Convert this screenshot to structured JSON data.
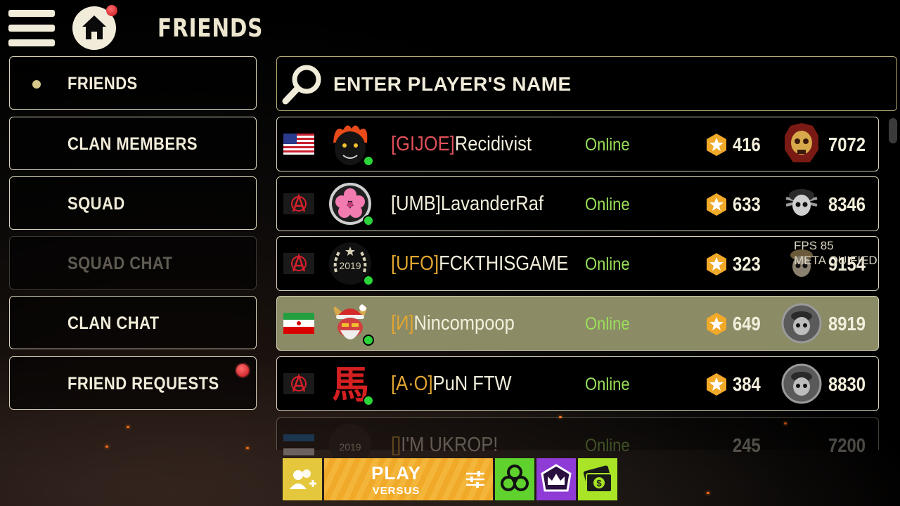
{
  "header": {
    "title": "FRIENDS"
  },
  "menu": [
    {
      "label": "FRIENDS",
      "active": true,
      "disabled": false,
      "notify": false
    },
    {
      "label": "CLAN MEMBERS",
      "active": false,
      "disabled": false,
      "notify": false
    },
    {
      "label": "SQUAD",
      "active": false,
      "disabled": false,
      "notify": false
    },
    {
      "label": "SQUAD CHAT",
      "active": false,
      "disabled": true,
      "notify": false
    },
    {
      "label": "CLAN CHAT",
      "active": false,
      "disabled": false,
      "notify": false
    },
    {
      "label": "FRIEND REQUESTS",
      "active": false,
      "disabled": false,
      "notify": true
    }
  ],
  "search": {
    "placeholder": "ENTER PLAYER'S NAME",
    "value": ""
  },
  "friends": [
    {
      "flag": "usa-flag",
      "avatar": "black-panther-fire-avatar",
      "tag": "[GIJOE]",
      "tag_color": "#e0505a",
      "name": "Recidivist",
      "status": "Online",
      "level": "416",
      "rank_icon": "golden-skull-rank-icon",
      "score": "7072"
    },
    {
      "flag": "anarchy-flag",
      "avatar": "pink-sakura-avatar",
      "tag": "[UMB]",
      "tag_color": "#f4efdc",
      "name": "LavanderRaf",
      "status": "Online",
      "level": "633",
      "rank_icon": "skull-beret-rank-icon",
      "score": "8346"
    },
    {
      "flag": "anarchy-flag",
      "avatar": "2019-laurel-avatar",
      "tag": "[UFO]",
      "tag_color": "#e0a531",
      "name": "FCKTHISGAME",
      "status": "Online",
      "level": "323",
      "rank_icon": "bronze-skull-rank-icon",
      "score": "9154"
    },
    {
      "flag": "iran-flag",
      "avatar": "santa-devil-avatar",
      "tag": "[И]",
      "tag_color": "#e0a531",
      "name": "Nincompoop",
      "status": "Online",
      "level": "649",
      "rank_icon": "silver-skull-rank-icon",
      "score": "8919",
      "selected": true
    },
    {
      "flag": "anarchy-flag",
      "avatar": "red-kanji-avatar",
      "tag": "[A·O]",
      "tag_color": "#e0a531",
      "name": "PuN FTW",
      "status": "Online",
      "level": "384",
      "rank_icon": "silver-skull-rank-icon",
      "score": "8830"
    },
    {
      "flag": "estonia-flag",
      "avatar": "2019-laurel-avatar",
      "tag": "[]",
      "tag_color": "#e0a531",
      "name": "I'M UKROP!",
      "status": "Online",
      "level": "245",
      "rank_icon": "bronze-skull-rank-icon",
      "score": "7200",
      "partial": true
    }
  ],
  "overlay": {
    "fps": "FPS 85",
    "meta": "META QUIFIED"
  },
  "bottom_bar": {
    "play_label": "PLAY",
    "play_mode": "VERSUS"
  },
  "colors": {
    "accent": "#f0a928",
    "online": "#9be05a",
    "selected_row": "#8b8b66"
  }
}
